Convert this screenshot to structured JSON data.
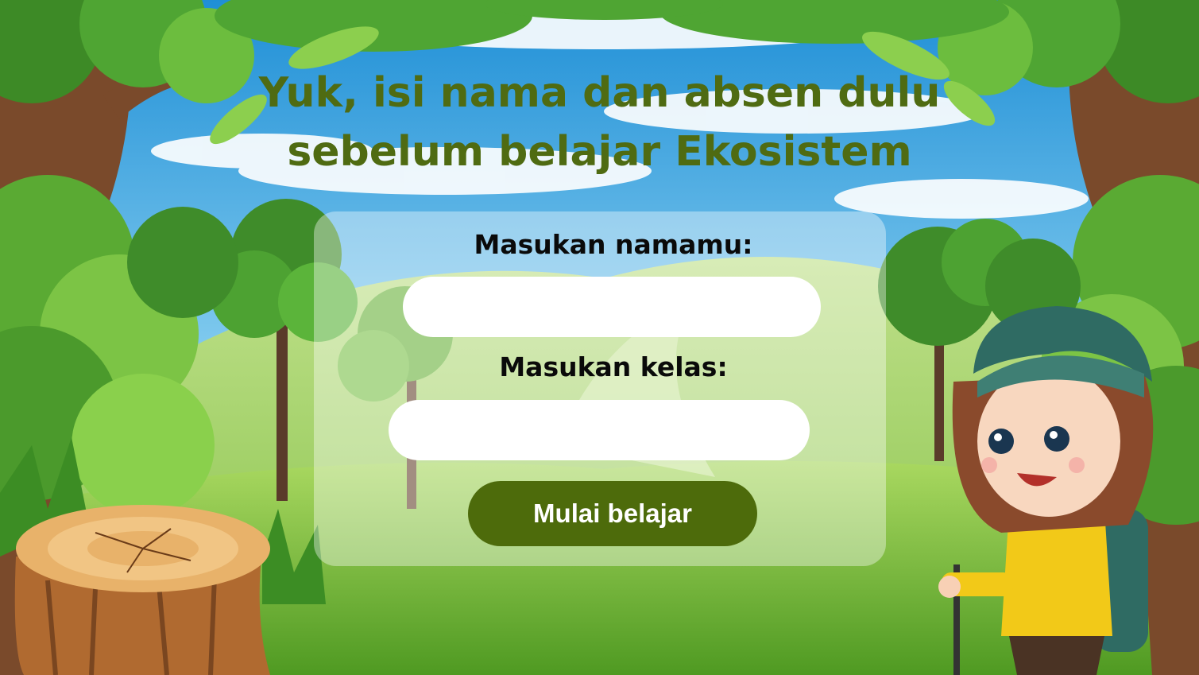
{
  "title": {
    "line1": "Yuk, isi nama dan absen dulu",
    "line2": "sebelum belajar Ekosistem"
  },
  "form": {
    "name_label": "Masukan namamu:",
    "name_value": "",
    "class_label": "Masukan kelas:",
    "class_value": "",
    "submit_label": "Mulai belajar"
  },
  "colors": {
    "title": "#4f6b12",
    "button": "#4d6b0b",
    "sky": "#5ab8e8",
    "grass": "#7cb832"
  },
  "decor": [
    "forest-background",
    "tree-stump",
    "girl-hiker-character"
  ]
}
